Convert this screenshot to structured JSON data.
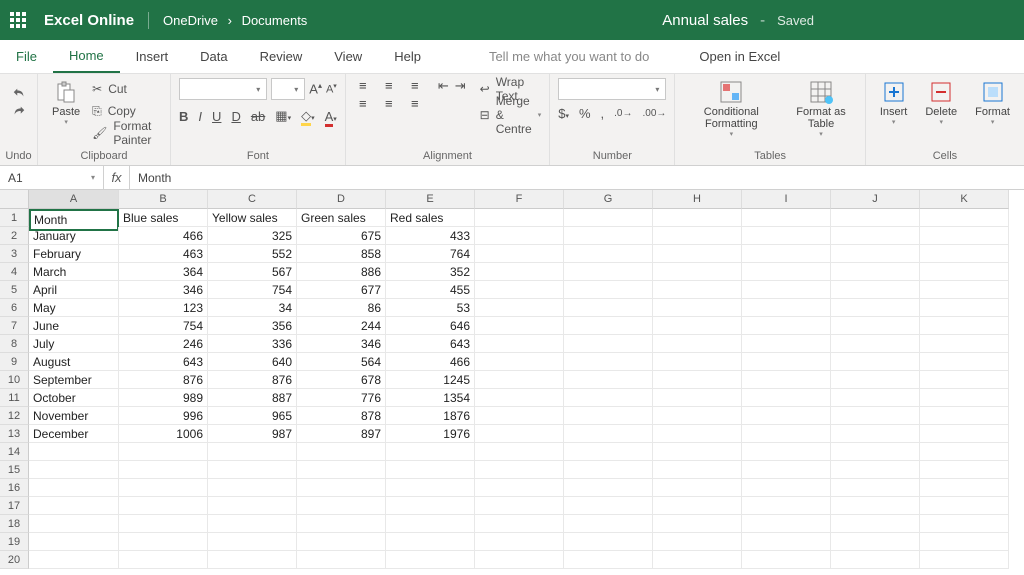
{
  "topbar": {
    "appname": "Excel Online",
    "crumb1": "OneDrive",
    "crumb2": "Documents",
    "docname": "Annual sales",
    "saved": "Saved"
  },
  "tabs": {
    "file": "File",
    "home": "Home",
    "insert": "Insert",
    "data": "Data",
    "review": "Review",
    "view": "View",
    "help": "Help",
    "tellme": "Tell me what you want to do",
    "open": "Open in Excel"
  },
  "ribbon": {
    "undo": "Undo",
    "paste": "Paste",
    "cut": "Cut",
    "copy": "Copy",
    "formatpainter": "Format Painter",
    "clipboard": "Clipboard",
    "font": "Font",
    "wrap": "Wrap Text",
    "merge": "Merge & Centre",
    "alignment": "Alignment",
    "number": "Number",
    "condfmt": "Conditional Formatting",
    "fmttable": "Format as Table",
    "tables": "Tables",
    "insert": "Insert",
    "delete": "Delete",
    "format": "Format",
    "cells": "Cells",
    "dollar": "$",
    "percent": "%",
    "comma": ",",
    "decinc": ".0",
    "decdec": ".00"
  },
  "fx": {
    "cellref": "A1",
    "value": "Month"
  },
  "columns": [
    "A",
    "B",
    "C",
    "D",
    "E",
    "F",
    "G",
    "H",
    "I",
    "J",
    "K"
  ],
  "sheet": {
    "headers": [
      "Month",
      "Blue sales",
      "Yellow sales",
      "Green sales",
      "Red sales"
    ],
    "rows": [
      [
        "January",
        466,
        325,
        675,
        433
      ],
      [
        "February",
        463,
        552,
        858,
        764
      ],
      [
        "March",
        364,
        567,
        886,
        352
      ],
      [
        "April",
        346,
        754,
        677,
        455
      ],
      [
        "May",
        123,
        34,
        86,
        53
      ],
      [
        "June",
        754,
        356,
        244,
        646
      ],
      [
        "July",
        246,
        336,
        346,
        643
      ],
      [
        "August",
        643,
        640,
        564,
        466
      ],
      [
        "September",
        876,
        876,
        678,
        1245
      ],
      [
        "October",
        989,
        887,
        776,
        1354
      ],
      [
        "November",
        996,
        965,
        878,
        1876
      ],
      [
        "December",
        1006,
        987,
        897,
        1976
      ]
    ]
  }
}
